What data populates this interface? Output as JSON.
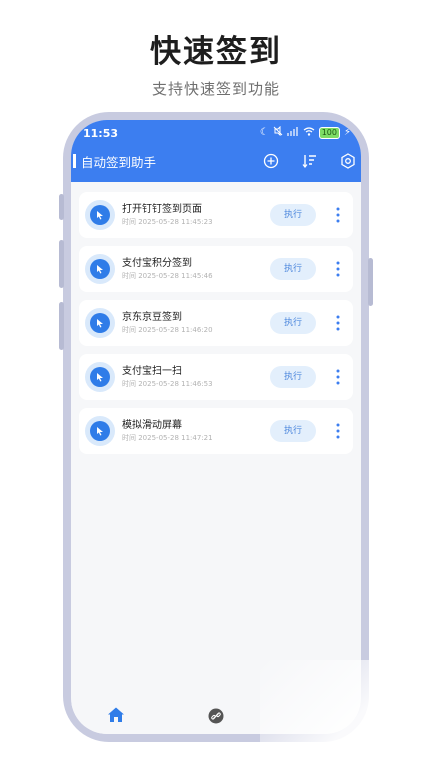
{
  "promo": {
    "title": "快速签到",
    "subtitle": "支持快速签到功能"
  },
  "status_bar": {
    "time": "11:53",
    "battery": "100"
  },
  "header": {
    "title": "自动签到助手",
    "icons": [
      "add-circle-icon",
      "sort-icon",
      "settings-icon"
    ]
  },
  "tasks": [
    {
      "name": "打开钉钉签到页面",
      "time": "时间 2025-05-28 11:45:23",
      "action": "执行"
    },
    {
      "name": "支付宝积分签到",
      "time": "时间 2025-05-28 11:45:46",
      "action": "执行"
    },
    {
      "name": "京东京豆签到",
      "time": "时间 2025-05-28 11:46:20",
      "action": "执行"
    },
    {
      "name": "支付宝扫一扫",
      "time": "时间 2025-05-28 11:46:53",
      "action": "执行"
    },
    {
      "name": "模拟滑动屏幕",
      "time": "时间 2025-05-28 11:47:21",
      "action": "执行"
    }
  ],
  "bottom_nav": [
    "home-icon",
    "link-icon"
  ],
  "colors": {
    "header": "#3c7ef0",
    "accent": "#2f7ce8",
    "button_bg": "#e3effc",
    "phone_frame": "#c8cbe0"
  }
}
